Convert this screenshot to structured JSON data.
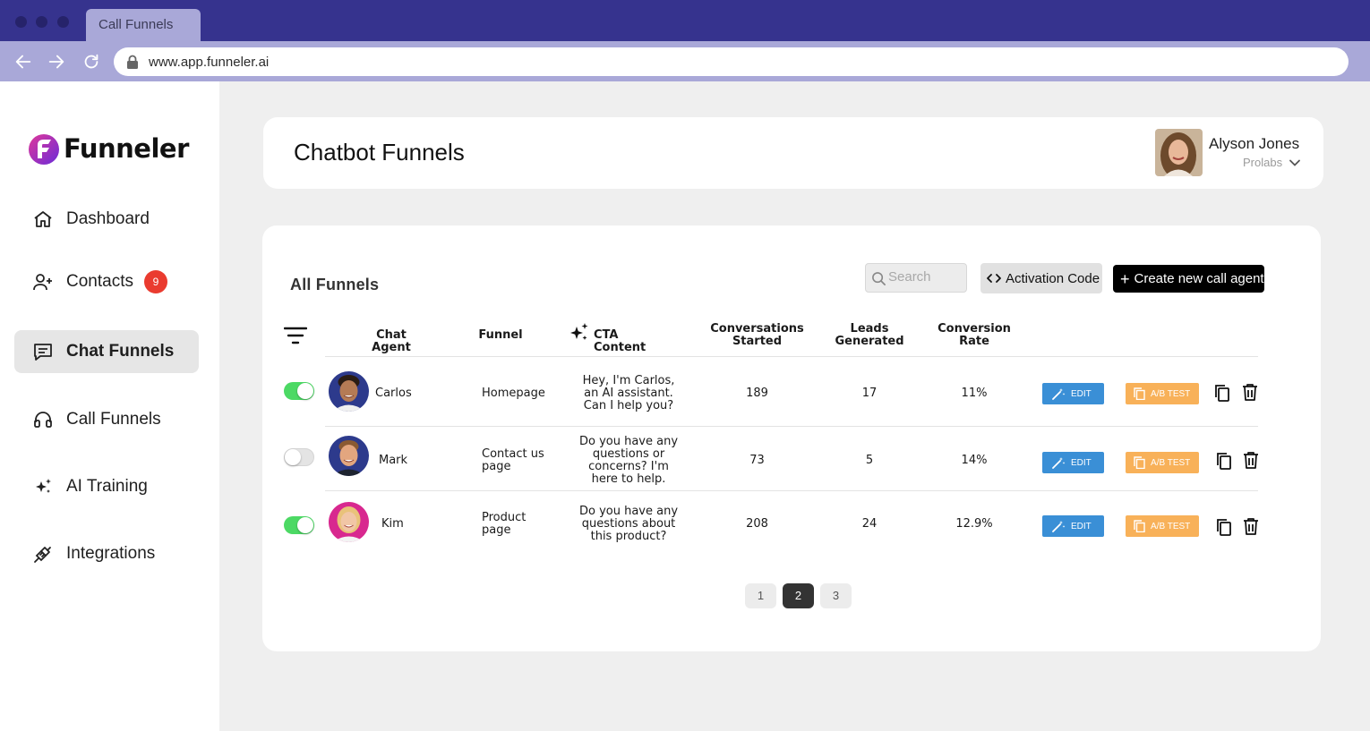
{
  "browser": {
    "tab_title": "Call Funnels",
    "url": "www.app.funneler.ai"
  },
  "sidebar": {
    "logo_text": "Funneler",
    "items": [
      {
        "label": "Dashboard",
        "icon": "home-icon"
      },
      {
        "label": "Contacts",
        "icon": "add-user-icon",
        "badge": "9"
      },
      {
        "label": "Chat Funnels",
        "icon": "chat-icon",
        "active": true
      },
      {
        "label": "Call Funnels",
        "icon": "headset-icon"
      },
      {
        "label": "AI Training",
        "icon": "sparkles-icon"
      },
      {
        "label": "Integrations",
        "icon": "plug-icon"
      }
    ]
  },
  "header": {
    "title": "Chatbot Funnels",
    "user_name": "Alyson Jones",
    "user_org": "Prolabs"
  },
  "funnels": {
    "section_title": "All Funnels",
    "search_placeholder": "Search",
    "activation_label": "Activation Code",
    "create_label": "Create new call agent",
    "columns": {
      "agent": "Chat Agent",
      "funnel": "Funnel",
      "cta": "CTA Content",
      "conversations_1": "Conversations",
      "conversations_2": "Started",
      "leads_1": "Leads",
      "leads_2": "Generated",
      "conversion_1": "Conversion",
      "conversion_2": "Rate"
    },
    "rows": [
      {
        "enabled": true,
        "agent": "Carlos",
        "funnel_1": "Homepage",
        "funnel_2": "",
        "cta_1": "Hey, I'm Carlos,",
        "cta_2": "an AI assistant.",
        "cta_3": "Can I help you?",
        "cta_4": "",
        "conversations": "189",
        "leads": "17",
        "conversion": "11%",
        "edit_label": "EDIT",
        "ab_label": "A/B TEST"
      },
      {
        "enabled": false,
        "agent": "Mark",
        "funnel_1": "Contact us",
        "funnel_2": "page",
        "cta_1": "Do you have any",
        "cta_2": "questions or",
        "cta_3": "concerns? I'm",
        "cta_4": "here to help.",
        "conversations": "73",
        "leads": "5",
        "conversion": "14%",
        "edit_label": "EDIT",
        "ab_label": "A/B TEST"
      },
      {
        "enabled": true,
        "agent": "Kim",
        "funnel_1": "Product",
        "funnel_2": "page",
        "cta_1": "Do you have any",
        "cta_2": "questions about",
        "cta_3": "this product?",
        "cta_4": "",
        "conversations": "208",
        "leads": "24",
        "conversion": "12.9%",
        "edit_label": "EDIT",
        "ab_label": "A/B TEST"
      }
    ],
    "pagination": [
      "1",
      "2",
      "3"
    ],
    "current_page": "2"
  },
  "colors": {
    "chrome": "#36338e",
    "toolbar": "#a9a8d8",
    "toggle_on": "#4cd964",
    "edit": "#3a8fd6",
    "ab_test": "#f8b159",
    "badge": "#ea3b2f"
  }
}
